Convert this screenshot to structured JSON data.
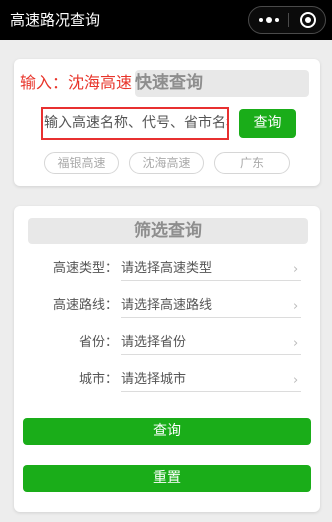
{
  "header": {
    "title": "高速路况查询"
  },
  "quick_search": {
    "annotation": "输入：沈海高速",
    "title": "快速查询",
    "input_placeholder": "输入高速名称、代号、省市名称",
    "search_button": "查询",
    "suggestions": [
      "福银高速",
      "沈海高速",
      "广东"
    ]
  },
  "filter": {
    "title": "筛选查询",
    "rows": [
      {
        "label": "高速类型：",
        "placeholder": "请选择高速类型"
      },
      {
        "label": "高速路线：",
        "placeholder": "请选择高速路线"
      },
      {
        "label": "省份：",
        "placeholder": "请选择省份"
      },
      {
        "label": "城市：",
        "placeholder": "请选择城市"
      }
    ],
    "query_button": "查询",
    "reset_button": "重置"
  },
  "colors": {
    "accent_green": "#1aad19",
    "annotation_red": "#e8352b",
    "topbar": "#000000",
    "background": "#ededed"
  }
}
